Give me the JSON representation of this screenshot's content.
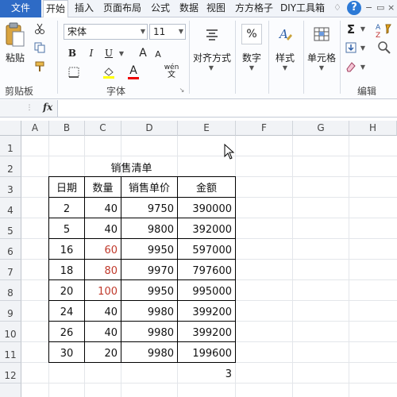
{
  "tabs": {
    "file": "文件",
    "items": [
      "开始",
      "插入",
      "页面布局",
      "公式",
      "数据",
      "视图",
      "方方格子",
      "DIY工具箱"
    ]
  },
  "ribbon": {
    "clipboard": {
      "paste": "粘贴",
      "group": "剪贴板"
    },
    "font": {
      "name": "宋体",
      "size": "11",
      "group": "字体",
      "bold": "B",
      "italic": "I",
      "underline": "U",
      "grow": "A",
      "shrink": "A",
      "color_a": "A",
      "phonetic": "wén"
    },
    "align": {
      "label": "对齐方式"
    },
    "number": {
      "label": "数字",
      "icon_text": "%"
    },
    "style": {
      "label": "样式"
    },
    "cells": {
      "label": "单元格"
    },
    "edit": {
      "label": "编辑",
      "sigma": "Σ"
    }
  },
  "formula_bar": {
    "fx": "fx"
  },
  "columns": [
    "A",
    "B",
    "C",
    "D",
    "E",
    "F",
    "G",
    "H"
  ],
  "rows": [
    "1",
    "2",
    "3",
    "4",
    "5",
    "6",
    "7",
    "8",
    "9",
    "10",
    "11",
    "12"
  ],
  "sheet": {
    "title": "销售清单",
    "headers": [
      "日期",
      "数量",
      "销售单价",
      "金额"
    ],
    "data": [
      [
        "2",
        "40",
        "9750",
        "390000"
      ],
      [
        "5",
        "40",
        "9800",
        "392000"
      ],
      [
        "16",
        "60",
        "9950",
        "597000"
      ],
      [
        "18",
        "80",
        "9970",
        "797600"
      ],
      [
        "20",
        "100",
        "9950",
        "995000"
      ],
      [
        "24",
        "40",
        "9980",
        "399200"
      ],
      [
        "26",
        "40",
        "9980",
        "399200"
      ],
      [
        "30",
        "20",
        "9980",
        "199600"
      ]
    ],
    "red_qty_rows": [
      2,
      3,
      4
    ],
    "e12": "3"
  },
  "colors": {
    "file_tab": "#2e6bc6",
    "red_text": "#c0392b",
    "help": "#2d7ad6"
  }
}
